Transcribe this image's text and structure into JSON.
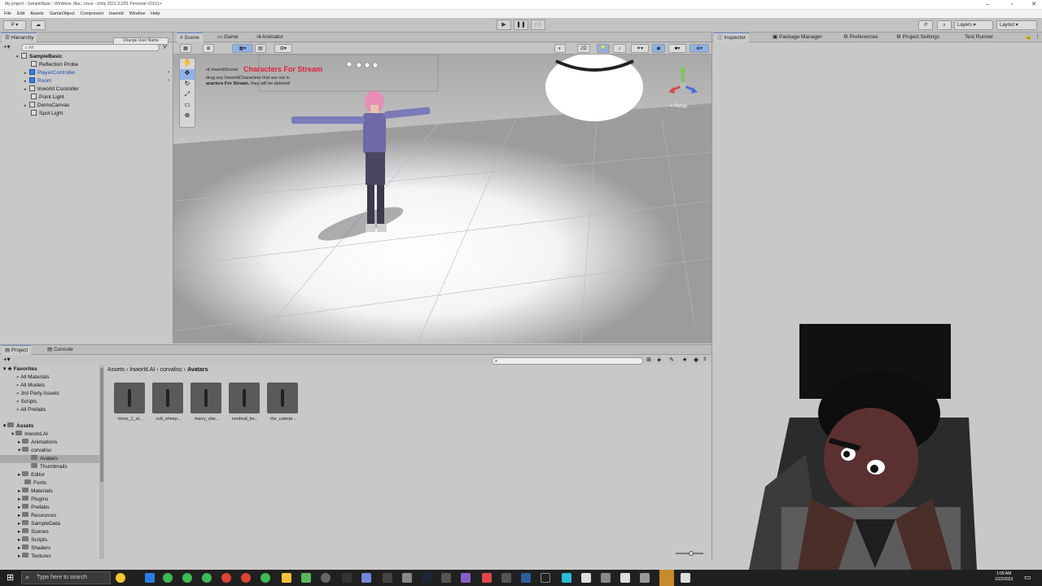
{
  "window": {
    "title": "My project - SampleBasic - Windows, Mac, Linux - Unity 2021.3.22f1 Personal <DX11>"
  },
  "menu": [
    "File",
    "Edit",
    "Assets",
    "GameObject",
    "Component",
    "Inworld",
    "Window",
    "Help"
  ],
  "toolbar": {
    "account": "P",
    "layers": "Layers",
    "layout": "Layout"
  },
  "hierarchy": {
    "tab": "Hierarchy",
    "search_placeholder": "All",
    "tooltip": "Change User Name",
    "items": [
      {
        "label": "SampleBasic"
      },
      {
        "label": "Reflection Probe"
      },
      {
        "label": "PlayerController"
      },
      {
        "label": "Room"
      },
      {
        "label": "Inworld Controller"
      },
      {
        "label": "Point Light"
      },
      {
        "label": "DemoCanvas"
      },
      {
        "label": "Spot Light"
      }
    ]
  },
  "scene": {
    "tabs": [
      "Scene",
      "Game",
      "Animator"
    ],
    "mode_2d": "2D",
    "overlay_title": "Characters For Stream",
    "overlay_line1": "nt InworldScene",
    "overlay_line2": "drag any InworldCharacters that are not in",
    "overlay_line3": "aracters For Stream",
    "overlay_line3b": ", they will be deleted!",
    "persp": "< Persp"
  },
  "inspector": {
    "tabs": [
      "Inspector",
      "Package Manager",
      "Preferences",
      "Project Settings",
      "Test Runner"
    ]
  },
  "project": {
    "tabs": [
      "Project",
      "Console"
    ],
    "breadcrumb": [
      "Assets",
      "Inworld.AI",
      "corvalisc",
      "Avatars"
    ],
    "favorites_label": "Favorites",
    "favorites": [
      "All Materials",
      "All Models",
      "3rd Party Assets",
      "Scripts",
      "All Prefabs"
    ],
    "assets_label": "Assets",
    "tree": [
      "Inworld.AI",
      "Animations",
      "corvalisc",
      "Avatars",
      "Thumbnails",
      "Editor",
      "Fonts",
      "Materials",
      "Plugins",
      "Prefabs",
      "Resources",
      "SampleData",
      "Scenes",
      "Scripts",
      "Shaders",
      "Textures"
    ],
    "items": [
      "clone_1_st...",
      "cult_sheep...",
      "marry_she...",
      "medival_kn...",
      "the_caterpi..."
    ],
    "count": "3"
  },
  "taskbar": {
    "search_placeholder": "Type here to search",
    "time": "1:09 AM",
    "date": "1/22/2023"
  }
}
